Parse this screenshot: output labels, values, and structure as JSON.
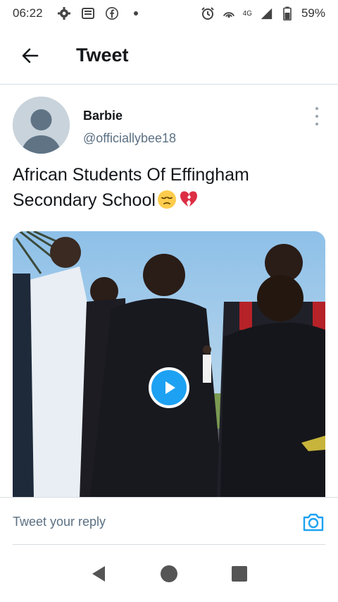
{
  "status_bar": {
    "time": "06:22",
    "network_type": "4G",
    "battery_percent": "59%",
    "icons": [
      "settings-icon",
      "newspaper-icon",
      "facebook-icon",
      "dot-icon",
      "alarm-icon",
      "hotspot-icon",
      "signal-icon",
      "battery-icon"
    ]
  },
  "header": {
    "title": "Tweet",
    "back_icon": "arrow-left-icon"
  },
  "tweet": {
    "author": {
      "name": "Barbie",
      "handle": "@officiallybee18"
    },
    "text": "African Students Of Effingham Secondary School",
    "emojis": [
      "pensive-face",
      "broken-heart"
    ],
    "media": {
      "type": "video",
      "play_icon": "play-icon"
    }
  },
  "reply": {
    "placeholder": "Tweet your reply",
    "camera_icon": "camera-icon"
  },
  "nav_bar": {
    "buttons": [
      "back-triangle-icon",
      "home-circle-icon",
      "recents-square-icon"
    ]
  },
  "colors": {
    "accent": "#1da1f2",
    "secondary_text": "#5b7083",
    "divider": "#d9dde1"
  }
}
